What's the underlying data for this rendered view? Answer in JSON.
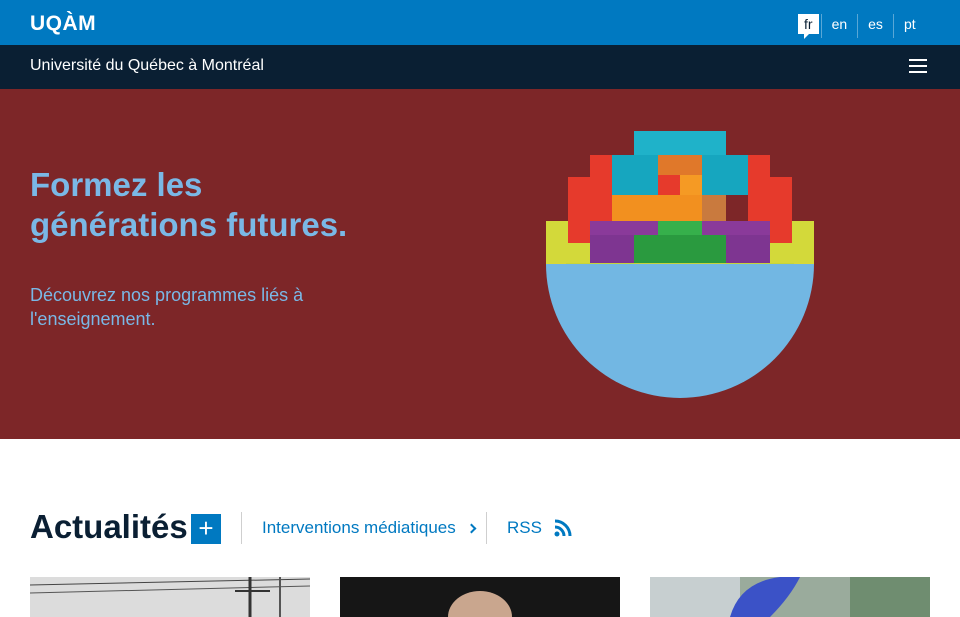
{
  "header": {
    "logo": "UQÀM",
    "languages": [
      {
        "code": "fr",
        "active": true
      },
      {
        "code": "en",
        "active": false
      },
      {
        "code": "es",
        "active": false
      },
      {
        "code": "pt",
        "active": false
      }
    ],
    "university_name": "Université du Québec à Montréal",
    "menu_icon": "hamburger-menu-icon"
  },
  "hero": {
    "title": "Formez les générations futures.",
    "subtitle": "Découvrez nos programmes liés à l'enseignement.",
    "background_color": "#7d2628",
    "text_color": "#7ab8e6",
    "image": "colorful-puzzle-hemisphere"
  },
  "news": {
    "title": "Actualités",
    "add_icon": "plus-icon",
    "links": [
      {
        "label": "Interventions médiatiques",
        "icon": "chevron-right-icon"
      },
      {
        "label": "RSS",
        "icon": "rss-icon"
      }
    ],
    "cards": [
      {
        "image": "power-lines-photo"
      },
      {
        "image": "person-portrait-photo"
      },
      {
        "image": "gloved-hand-photo"
      }
    ]
  },
  "colors": {
    "primary_blue": "#0079c1",
    "navy": "#0a1f33"
  }
}
